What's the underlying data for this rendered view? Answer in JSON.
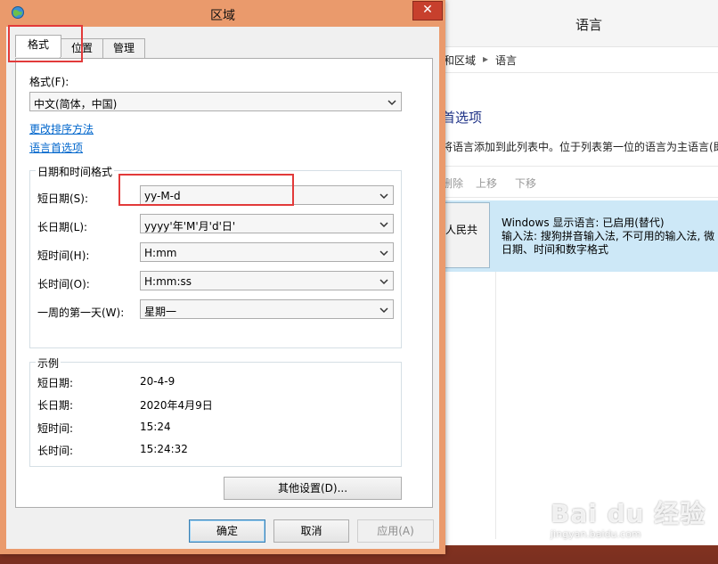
{
  "background_window": {
    "title": "语言",
    "breadcrumb": [
      "和区域",
      "语言"
    ],
    "heading": "首选项",
    "description": "将语言添加到此列表中。位于列表第一位的语言为主语言(即你",
    "toolbar": [
      "删除",
      "上移",
      "下移"
    ],
    "language_item": {
      "name": "人民共",
      "line1": "Windows 显示语言: 已启用(替代)",
      "line2": "输入法: 搜狗拼音输入法, 不可用的输入法, 微",
      "line3": "日期、时间和数字格式"
    }
  },
  "watermark": {
    "logo": "Bai du 经验",
    "sub": "jingyan.baidu.com"
  },
  "dialog": {
    "title": "区域",
    "close_glyph": "✕",
    "tabs": [
      {
        "label": "格式",
        "active": true
      },
      {
        "label": "位置",
        "active": false
      },
      {
        "label": "管理",
        "active": false
      }
    ],
    "format_label": "格式(F):",
    "format_value": "中文(简体，中国)",
    "link_sort": "更改排序方法",
    "link_language": "语言首选项",
    "datetime_group": {
      "title": "日期和时间格式",
      "rows": [
        {
          "label": "短日期(S):",
          "value": "yy-M-d"
        },
        {
          "label": "长日期(L):",
          "value": "yyyy'年'M'月'd'日'"
        },
        {
          "label": "短时间(H):",
          "value": "H:mm"
        },
        {
          "label": "长时间(O):",
          "value": "H:mm:ss"
        },
        {
          "label": "一周的第一天(W):",
          "value": "星期一"
        }
      ]
    },
    "example_group": {
      "title": "示例",
      "rows": [
        {
          "label": "短日期:",
          "value": "20-4-9"
        },
        {
          "label": "长日期:",
          "value": "2020年4月9日"
        },
        {
          "label": "短时间:",
          "value": "15:24"
        },
        {
          "label": "长时间:",
          "value": "15:24:32"
        }
      ]
    },
    "other_settings": "其他设置(D)...",
    "buttons": {
      "ok": "确定",
      "cancel": "取消",
      "apply": "应用(A)"
    }
  },
  "colors": {
    "highlight_box": "#e23a3a",
    "link": "#0066cc",
    "selection": "#cde8f7",
    "dialog_frame": "#ea9a6c"
  }
}
